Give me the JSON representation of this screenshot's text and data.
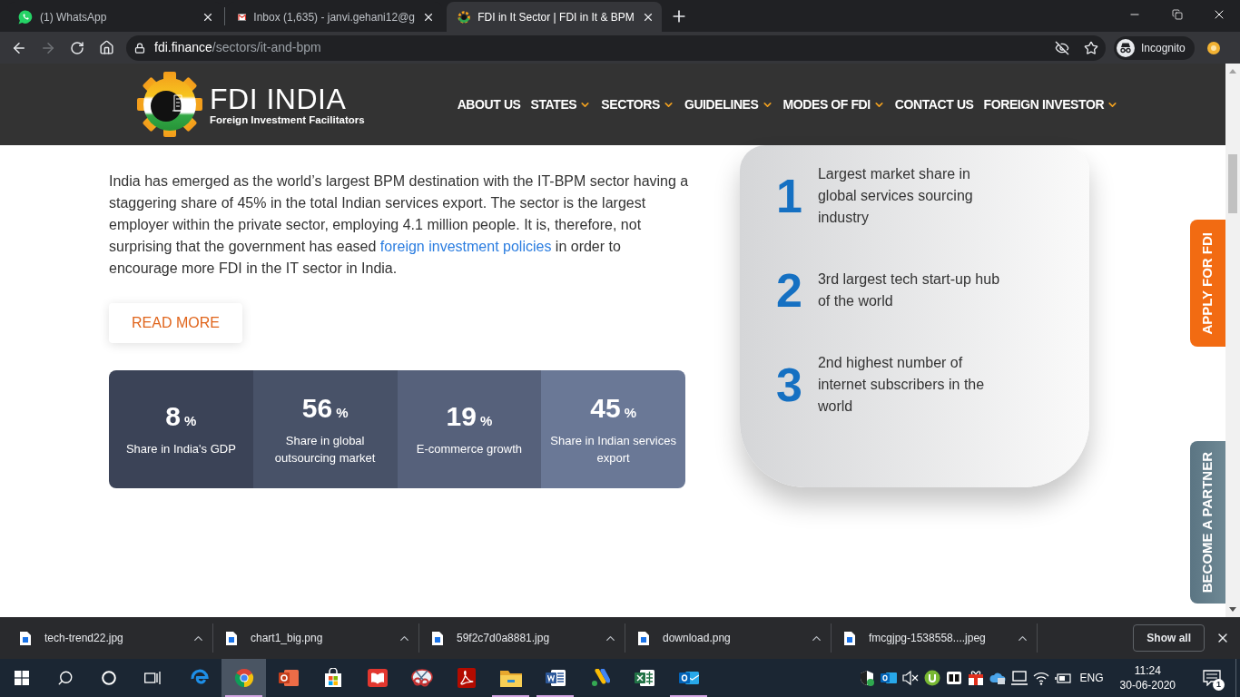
{
  "browser": {
    "tabs": [
      {
        "title": "(1) WhatsApp",
        "selected": false
      },
      {
        "title": "Inbox (1,635) - janvi.gehani12@g",
        "selected": false
      },
      {
        "title": "FDI in It Sector | FDI in It & BPM",
        "selected": true
      }
    ],
    "forward_disabled": true,
    "url_host": "fdi.finance",
    "url_path": "/sectors/it-and-bpm",
    "profile_label": "Incognito"
  },
  "site": {
    "logo": {
      "title": "FDI INDIA",
      "tagline": "Foreign Investment Facilitators"
    },
    "nav": [
      {
        "label": "ABOUT US",
        "has_dropdown": false
      },
      {
        "label": "STATES",
        "has_dropdown": true
      },
      {
        "label": "SECTORS",
        "has_dropdown": true
      },
      {
        "label": "GUIDELINES",
        "has_dropdown": true
      },
      {
        "label": "MODES OF FDI",
        "has_dropdown": true
      },
      {
        "label": "CONTACT US",
        "has_dropdown": false
      },
      {
        "label": "FOREIGN INVESTOR",
        "has_dropdown": true
      }
    ],
    "intro": {
      "before": "India has emerged as the world’s largest BPM destination with the IT-BPM sector having a staggering share of 45% in the total Indian services export. The sector is the largest employer within the private sector, employing 4.1 million people. It is, therefore, not surprising that the government has eased ",
      "link": "foreign investment policies",
      "after": " in order to encourage more FDI in the IT sector in India."
    },
    "read_more": "READ MORE",
    "stats": [
      {
        "value": "8",
        "unit": "%",
        "label": "Share in India's GDP",
        "color": "#3b4357"
      },
      {
        "value": "56",
        "unit": "%",
        "label": "Share in global outsourcing market",
        "color": "#485268"
      },
      {
        "value": "19",
        "unit": "%",
        "label": "E-commerce growth",
        "color": "#56617b"
      },
      {
        "value": "45",
        "unit": "%",
        "label": "Share in Indian services export",
        "color": "#6a7896"
      }
    ],
    "highlights": [
      {
        "number": "1",
        "text": "Largest market share in global services sourcing industry"
      },
      {
        "number": "2",
        "text": "3rd largest tech start-up hub of the world"
      },
      {
        "number": "3",
        "text": "2nd highest number of internet subscribers in the world"
      }
    ],
    "side_tabs": [
      {
        "label": "APPLY FOR FDI",
        "kind": "apply"
      },
      {
        "label": "BECOME A PARTNER",
        "kind": "partner"
      }
    ]
  },
  "downloads": {
    "files": [
      "tech-trend22.jpg",
      "chart1_big.png",
      "59f2c7d0a8881.jpg",
      "download.png",
      "fmcgjpg-1538558....jpeg"
    ],
    "show_all": "Show all"
  },
  "taskbar": {
    "apps": [
      {
        "running": false,
        "selected": false
      },
      {
        "running": true,
        "selected": true
      },
      {
        "running": false,
        "selected": false
      },
      {
        "running": false,
        "selected": false
      },
      {
        "running": false,
        "selected": false
      },
      {
        "running": false,
        "selected": false
      },
      {
        "running": false,
        "selected": false
      },
      {
        "running": true,
        "selected": false
      },
      {
        "running": true,
        "selected": false
      },
      {
        "running": false,
        "selected": false
      },
      {
        "running": false,
        "selected": false
      },
      {
        "running": true,
        "selected": false
      }
    ],
    "language": "ENG",
    "time": "11:24",
    "date": "30-06-2020",
    "notification_count": "1"
  }
}
